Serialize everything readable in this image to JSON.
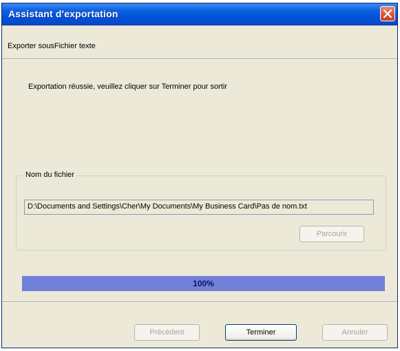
{
  "window": {
    "title": "Assistant d'exportation"
  },
  "header": {
    "export_type": "Exporter sousFichier texte"
  },
  "main": {
    "message": "Exportation réussie, veuillez cliquer sur Terminer pour sortir"
  },
  "file_group": {
    "label": "Nom du fichier",
    "path_value": "D:\\Documents and Settings\\Cher\\My Documents\\My Business Card\\Pas de nom.txt",
    "browse_label": "Parcourir"
  },
  "progress": {
    "value": 100,
    "text": "100%"
  },
  "footer": {
    "previous_label": "Précédent",
    "finish_label": "Terminer",
    "cancel_label": "Annuler"
  },
  "colors": {
    "titlebar": "#0a5fe0",
    "progress_fill": "#7180d8",
    "close_button": "#d75a3c"
  }
}
